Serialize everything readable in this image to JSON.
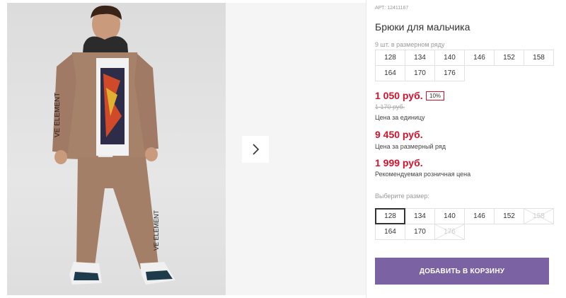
{
  "product": {
    "sku": "АРТ: 12411167",
    "title": "Брюки для мальчика",
    "pack_note": "9 шт. в размерном ряду",
    "pack_sizes": [
      "128",
      "134",
      "140",
      "146",
      "152",
      "158",
      "164",
      "170",
      "176"
    ],
    "price": "1 050 руб.",
    "discount": "10%",
    "old_price": "1 170 руб.",
    "price_label": "Цена за единицу",
    "pack_price": "9 450 руб.",
    "pack_price_label": "Цена за размерный ряд",
    "retail_price": "1 999 руб.",
    "retail_price_label": "Рекомендуемая розничная цена",
    "choose_label": "Выберите размер:",
    "choose_sizes": [
      {
        "label": "128",
        "state": "selected"
      },
      {
        "label": "134",
        "state": "available"
      },
      {
        "label": "140",
        "state": "available"
      },
      {
        "label": "146",
        "state": "available"
      },
      {
        "label": "152",
        "state": "available"
      },
      {
        "label": "158",
        "state": "unavailable"
      },
      {
        "label": "164",
        "state": "available"
      },
      {
        "label": "170",
        "state": "available"
      },
      {
        "label": "176",
        "state": "unavailable"
      }
    ],
    "add_to_cart": "ДОБАВИТЬ В КОРЗИНУ"
  },
  "gallery": {
    "next_icon": "chevron-right-icon"
  },
  "colors": {
    "price_red": "#d6112b",
    "button_purple": "#7b62a3"
  }
}
